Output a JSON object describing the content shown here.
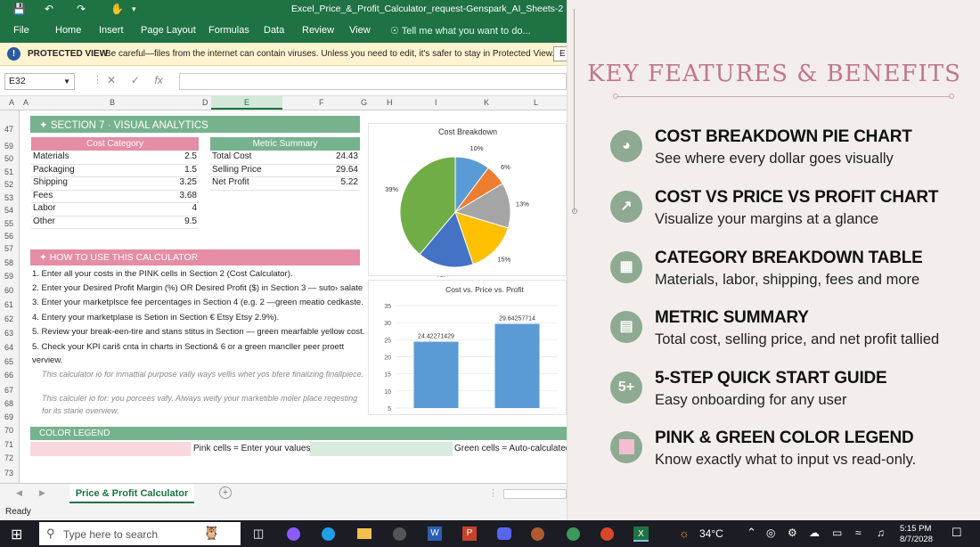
{
  "titlebar": {
    "doc_title": "Excel_Price_&_Profit_Calculator_request-Genspark_AI_Sheets-20860007"
  },
  "ribbon": {
    "tabs": [
      "File",
      "Home",
      "Insert",
      "Page Layout",
      "Formulas",
      "Data",
      "Review",
      "View"
    ],
    "tell_me": "Tell me what you want to do..."
  },
  "protected": {
    "label": "PROTECTED VIEW",
    "message": "Be careful—files from the internet can contain viruses. Unless you need to edit, it's safer to stay in Protected View.",
    "button": "E"
  },
  "formula_bar": {
    "name_box": "E32",
    "fx": "fx"
  },
  "columns": [
    "A",
    "B",
    "C",
    "D",
    "E",
    "F",
    "G",
    "H",
    "I",
    "J",
    "K",
    "L"
  ],
  "rows": [
    "47",
    "59",
    "50",
    "51",
    "52",
    "53",
    "54",
    "55",
    "56",
    "57",
    "58",
    "59",
    "60",
    "61",
    "62",
    "63",
    "64",
    "65",
    "66",
    "67",
    "68",
    "69",
    "70",
    "71",
    "72",
    "73",
    "74"
  ],
  "section7": {
    "title": "✦  SECTION 7  ·  VISUAL ANALYTICS"
  },
  "cost_table": {
    "header": "Cost Category",
    "rows": [
      {
        "label": "Materials",
        "value": "2.5"
      },
      {
        "label": "Packaging",
        "value": "1.5"
      },
      {
        "label": "Shipping",
        "value": "3.25"
      },
      {
        "label": "Fees",
        "value": "3.68"
      },
      {
        "label": "Labor",
        "value": "4"
      },
      {
        "label": "Other",
        "value": "9.5"
      }
    ]
  },
  "metric_table": {
    "header": "Metric Summary",
    "rows": [
      {
        "label": "Total Cost",
        "value": "24.43"
      },
      {
        "label": "Selling Price",
        "value": "29.64"
      },
      {
        "label": "Net Profit",
        "value": "5.22"
      }
    ]
  },
  "howto": {
    "title": "✦  HOW TO USE THIS CALCULATOR",
    "steps": [
      "1.  Enter all your costs in the PINK cells in Section 2 (Cost Calculator).",
      "2.  Enter your Desired Profit Margin (%) OR Desired Profit ($) in Section 3 — suto› salate",
      "3.  Enter your marketplsce fee percentages in Section 4 (e.g. 2 —green meatio cedkaste.",
      "4.  Entery your marketplase is Setion in Section € Etsy Etsy 2.9%).",
      "5.  Review your break-een-tire and stans stitus in Section — green mearfable yellow cost.",
      "5.  Check your KPI cariš cnta in charts in Section& 6 or a green mancller peer proett",
      "     verview."
    ],
    "notes": [
      "This calculator io for inmattial purpose vally ways vellis whet yos bfere finalizing finallpiece.",
      "This calculer io for: you porcees vafy. Always weify your marketible moler place reqesting",
      "for its starie overview."
    ]
  },
  "legend": {
    "title": "COLOR LEGEND",
    "pink": "Pink cells = Enter your values",
    "green": "Green cells = Auto-calculated"
  },
  "colors": {
    "pink": "#f8d7df",
    "green": "#d7ecdc",
    "excel_green": "#1f7244",
    "accent_rose": "#c0778c",
    "icon_sage": "#8eaa92"
  },
  "chart_data": [
    {
      "type": "pie",
      "title": "Cost Breakdown",
      "labels": [
        "10%",
        "6%",
        "13%",
        "15%",
        "17%",
        "39%"
      ],
      "values": [
        2.5,
        1.5,
        3.25,
        3.68,
        4,
        9.5
      ],
      "colors": [
        "#5b9bd5",
        "#ed7d31",
        "#a5a5a5",
        "#ffc000",
        "#4472c4",
        "#70ad47"
      ]
    },
    {
      "type": "bar",
      "title": "Cost vs. Price vs. Profit",
      "values": [
        24.42271429,
        29.64257714
      ],
      "data_labels": [
        "24.42271429",
        "29.64257714"
      ],
      "yticks": [
        "35",
        "30",
        "25",
        "20",
        "15",
        "10",
        "5"
      ],
      "ylim": [
        5,
        35
      ],
      "color": "#5b9bd5"
    }
  ],
  "sheet_tabs": {
    "active": "Price & Profit Calculator"
  },
  "status": {
    "ready": "Ready"
  },
  "taskbar": {
    "search": "Type here to search",
    "temp": "34°C",
    "time": "5:15 PM",
    "date": "8/7/2028"
  },
  "panel": {
    "title": "KEY FEATURES & BENEFITS",
    "features": [
      {
        "icon": "pie-chart-icon",
        "heading": "COST BREAKDOWN PIE CHART",
        "sub": "See where every dollar goes visually"
      },
      {
        "icon": "trend-arrow-icon",
        "heading": "COST VS PRICE VS PROFIT CHART",
        "sub": "Visualize your margins at a glance"
      },
      {
        "icon": "table-chart-icon",
        "heading": "CATEGORY BREAKDOWN TABLE",
        "sub": "Materials, labor, shipping, fees and more"
      },
      {
        "icon": "bar-chart-icon",
        "heading": "METRIC SUMMARY",
        "sub": "Total cost, selling price, and net profit tallied"
      },
      {
        "icon": "five-plus-icon",
        "icon_text": "5+",
        "heading": "5-STEP QUICK START GUIDE",
        "sub": "Easy onboarding for any user"
      },
      {
        "icon": "pink-square-icon",
        "heading": "PINK & GREEN COLOR LEGEND",
        "sub": "Know exactly what to input vs read-only."
      }
    ]
  }
}
